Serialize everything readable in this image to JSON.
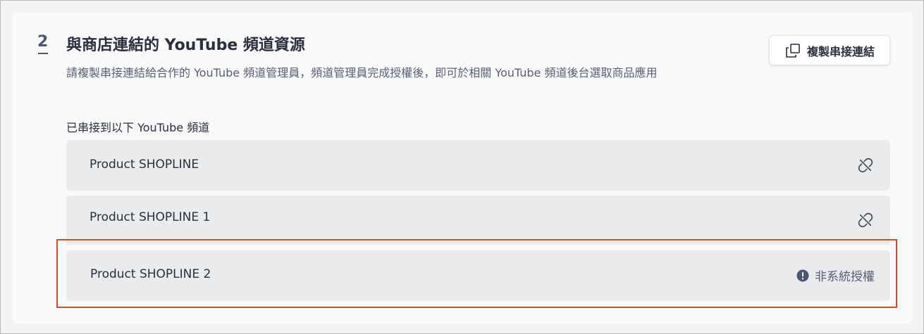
{
  "section": {
    "step_number": "2",
    "title": "與商店連結的 YouTube 頻道資源",
    "description": "請複製串接連結給合作的 YouTube 頻道管理員，頻道管理員完成授權後，即可於相關 YouTube 頻道後台選取商品應用",
    "copy_button_label": "複製串接連結",
    "copy_icon": "copy-icon"
  },
  "channels": {
    "heading": "已串接到以下 YouTube 頻道",
    "items": [
      {
        "name": "Product SHOPLINE",
        "action_icon": "unlink-icon"
      },
      {
        "name": "Product SHOPLINE 1",
        "action_icon": "unlink-icon"
      },
      {
        "name": "Product SHOPLINE 2",
        "status_icon": "alert-circle-icon",
        "status_text": "非系統授權"
      }
    ]
  },
  "colors": {
    "highlight_border": "#d9452e",
    "row_background": "#eaebed",
    "title_text": "#2a2f3d",
    "secondary_text": "#585f74",
    "step_number": "#4e5771"
  }
}
